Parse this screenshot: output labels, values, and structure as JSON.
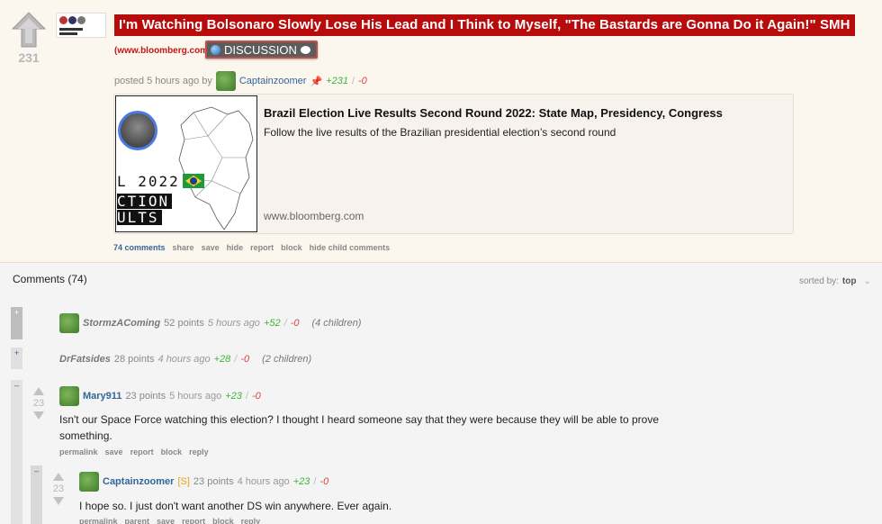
{
  "post": {
    "score": "231",
    "title": "I'm Watching Bolsonaro Slowly Lose His Lead and I Think to Myself, \"The Bastards are Gonna Do it Again!\" SMH",
    "domain": "(www.bloomberg.com)",
    "discussion_label": "DISCUSSION",
    "meta_prefix": "posted 5 hours ago by",
    "author": "Captainzoomer",
    "up": "+231",
    "sep": "/",
    "down": "-0",
    "card": {
      "title": "Brazil Election Live Results Second Round 2022: State Map, Presidency, Congress",
      "description": "Follow the live results of the Brazilian presidential election’s second round",
      "url": "www.bloomberg.com",
      "image_line1": "L 2022",
      "image_line2": "CTION",
      "image_line3": "ULTS"
    },
    "buttons": [
      "74 comments",
      "share",
      "save",
      "hide",
      "report",
      "block",
      "hide child comments"
    ]
  },
  "comments_header": {
    "title": "Comments (74)",
    "sorted_label": "sorted by:",
    "sorted_value": "top",
    "chevron": "⌄"
  },
  "comments": [
    {
      "toggle": "+",
      "author": "StormzAComing",
      "points": "52 points",
      "time": "5 hours ago",
      "up": "+52",
      "sep": "/",
      "down": "-0",
      "children": "(4 children)"
    },
    {
      "toggle": "+",
      "author": "DrFatsides",
      "points": "28 points",
      "time": "4 hours ago",
      "up": "+28",
      "sep": "/",
      "down": "-0",
      "children": "(2 children)"
    },
    {
      "toggle": "–",
      "score": "23",
      "author": "Mary911",
      "points": "23 points",
      "time": "5 hours ago",
      "up": "+23",
      "sep": "/",
      "down": "-0",
      "body": "Isn't our Space Force watching this election? I thought I heard someone say that they were because they will be able to prove something.",
      "buttons": [
        "permalink",
        "save",
        "report",
        "block",
        "reply"
      ]
    },
    {
      "toggle": "–",
      "score": "23",
      "author": "Captainzoomer",
      "flair": "[S]",
      "points": "23 points",
      "time": "4 hours ago",
      "up": "+23",
      "sep": "/",
      "down": "-0",
      "body": "I hope so. I just don't want another DS win anywhere. Ever again.",
      "buttons": [
        "permalink",
        "parent",
        "save",
        "report",
        "block",
        "reply"
      ]
    }
  ]
}
